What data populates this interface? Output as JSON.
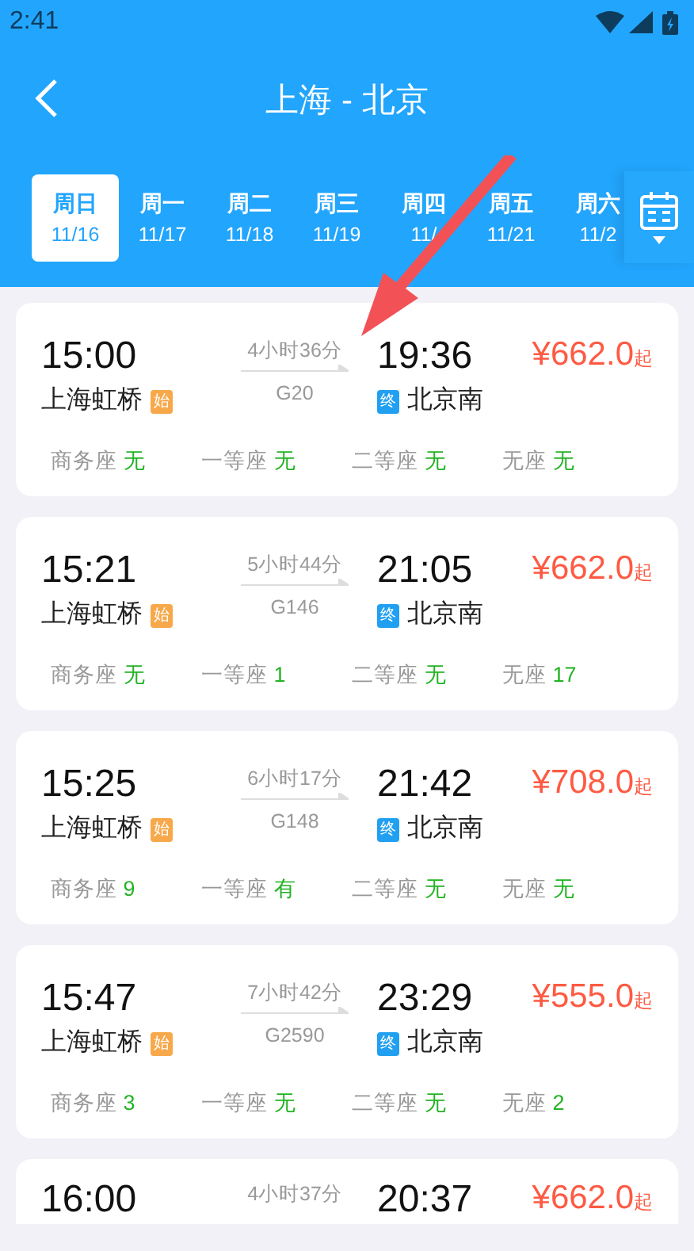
{
  "status_bar": {
    "time": "2:41"
  },
  "header": {
    "title": "上海 - 北京"
  },
  "date_tabs": [
    {
      "weekday": "周日",
      "date": "11/16",
      "selected": true
    },
    {
      "weekday": "周一",
      "date": "11/17",
      "selected": false
    },
    {
      "weekday": "周二",
      "date": "11/18",
      "selected": false
    },
    {
      "weekday": "周三",
      "date": "11/19",
      "selected": false
    },
    {
      "weekday": "周四",
      "date": "11/",
      "selected": false
    },
    {
      "weekday": "周五",
      "date": "11/21",
      "selected": false
    },
    {
      "weekday": "周六",
      "date": "11/2",
      "selected": false
    }
  ],
  "trains": [
    {
      "depart_time": "15:00",
      "depart_station": "上海虹桥",
      "depart_badge": "始",
      "duration": "4小时36分",
      "train_no": "G20",
      "arrive_time": "19:36",
      "arrive_badge": "终",
      "arrive_station": "北京南",
      "price": "¥662.0",
      "price_suffix": "起",
      "seats": [
        {
          "class": "商务座",
          "availability": "无"
        },
        {
          "class": "一等座",
          "availability": "无"
        },
        {
          "class": "二等座",
          "availability": "无"
        },
        {
          "class": "无座",
          "availability": "无"
        }
      ]
    },
    {
      "depart_time": "15:21",
      "depart_station": "上海虹桥",
      "depart_badge": "始",
      "duration": "5小时44分",
      "train_no": "G146",
      "arrive_time": "21:05",
      "arrive_badge": "终",
      "arrive_station": "北京南",
      "price": "¥662.0",
      "price_suffix": "起",
      "seats": [
        {
          "class": "商务座",
          "availability": "无"
        },
        {
          "class": "一等座",
          "availability": "1"
        },
        {
          "class": "二等座",
          "availability": "无"
        },
        {
          "class": "无座",
          "availability": "17"
        }
      ]
    },
    {
      "depart_time": "15:25",
      "depart_station": "上海虹桥",
      "depart_badge": "始",
      "duration": "6小时17分",
      "train_no": "G148",
      "arrive_time": "21:42",
      "arrive_badge": "终",
      "arrive_station": "北京南",
      "price": "¥708.0",
      "price_suffix": "起",
      "seats": [
        {
          "class": "商务座",
          "availability": "9"
        },
        {
          "class": "一等座",
          "availability": "有"
        },
        {
          "class": "二等座",
          "availability": "无"
        },
        {
          "class": "无座",
          "availability": "无"
        }
      ]
    },
    {
      "depart_time": "15:47",
      "depart_station": "上海虹桥",
      "depart_badge": "始",
      "duration": "7小时42分",
      "train_no": "G2590",
      "arrive_time": "23:29",
      "arrive_badge": "终",
      "arrive_station": "北京南",
      "price": "¥555.0",
      "price_suffix": "起",
      "seats": [
        {
          "class": "商务座",
          "availability": "3"
        },
        {
          "class": "一等座",
          "availability": "无"
        },
        {
          "class": "二等座",
          "availability": "无"
        },
        {
          "class": "无座",
          "availability": "2"
        }
      ]
    },
    {
      "depart_time": "16:00",
      "duration": "4小时37分",
      "arrive_time": "20:37",
      "price": "¥662.0",
      "price_suffix": "起"
    }
  ]
}
